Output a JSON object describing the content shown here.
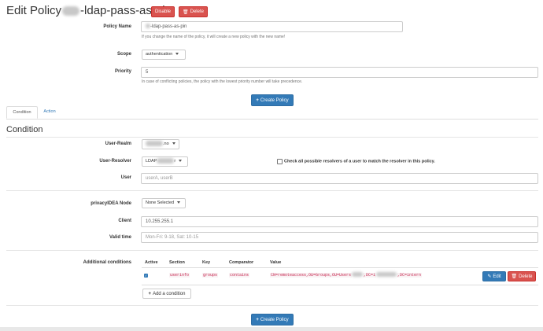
{
  "header": {
    "title_prefix": "Edit Policy",
    "title_suffix": "-ldap-pass-as-pin",
    "disable_label": "Disable",
    "delete_label": "Delete"
  },
  "policy": {
    "name_label": "Policy Name",
    "name_value": "-ldap-pass-as-pin",
    "name_help": "If you change the name of the policy, it will create a new policy with the new name!",
    "scope_label": "Scope",
    "scope_value": "authentication",
    "priority_label": "Priority",
    "priority_value": "5",
    "priority_help": "In case of conflicting policies, the policy with the lowest priority number will take precedence.",
    "create_label": "Create Policy"
  },
  "tabs": [
    {
      "label": "Condition"
    },
    {
      "label": "Action"
    }
  ],
  "condition": {
    "heading": "Condition",
    "realm_label": "User-Realm",
    "realm_value": ".no",
    "resolver_label": "User-Resolver",
    "resolver_value": "LDAP",
    "resolver_suffix": "r",
    "check_all_label": "Check all possible resolvers of a user to match the resolver in this policy.",
    "user_label": "User",
    "user_placeholder": "userA, userB",
    "node_label": "privacyIDEA Node",
    "node_value": "None Selected",
    "client_label": "Client",
    "client_value": "10.255.255.1",
    "valid_label": "Valid time",
    "valid_placeholder": "Mon-Fri: 9-18, Sat: 10-15"
  },
  "additional": {
    "label": "Additional conditions",
    "headers": [
      "Active",
      "Section",
      "Key",
      "Comparator",
      "Value"
    ],
    "row": {
      "section": "userinfo",
      "key": "groups",
      "comparator": "contains",
      "value_a": "CN=remoteaccess,OU=Groups,OU=Users",
      "value_b": ",DC=i",
      "value_c": ",DC=intern",
      "edit_label": "Edit",
      "delete_label": "Delete"
    },
    "add_label": "Add a condition"
  },
  "colors": {
    "danger": "#d9534f",
    "primary": "#337ab7"
  }
}
